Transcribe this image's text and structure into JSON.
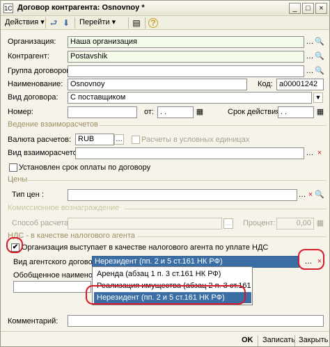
{
  "window": {
    "title": "Договор контрагента: Osnovnoy *",
    "icon_text": "1С"
  },
  "toolbar": {
    "actions": "Действия",
    "goto": "Перейти",
    "help": "?",
    "icons": [
      "write-back-icon",
      "down-arrow-icon",
      "table-icon"
    ]
  },
  "form": {
    "org_label": "Организация:",
    "org_value": "Наша организация",
    "contractor_label": "Контрагент:",
    "contractor_value": "Postavshik",
    "group_label": "Группа договоров:",
    "group_value": "",
    "name_label": "Наименование:",
    "name_value": "Osnovnoy",
    "code_label": "Код:",
    "code_value": "а00001242",
    "type_label": "Вид договора:",
    "type_value": "С поставщиком",
    "number_label": "Номер:",
    "number_value": "",
    "from_label": "от:",
    "from_value": " .  .",
    "term_label": "Срок действия:",
    "term_value": " .  .",
    "section_settlements": "Ведение взаиморасчетов",
    "currency_label": "Валюта расчетов:",
    "currency_value": "RUB",
    "conventional_label": "Расчеты в условных единицах",
    "settlement_type_label": "Вид взаиморасчетов:",
    "settlement_type_value": "",
    "payment_term_label": "Установлен срок оплаты по договору",
    "section_prices": "Цены",
    "price_type_label": "Тип цен :",
    "price_type_value": "",
    "section_commission": "Комиссионное вознаграждение",
    "calc_method_label": "Способ расчета:",
    "calc_method_value": "",
    "percent_label": "Процент:",
    "percent_value": "0,00",
    "section_vat": "НДС - в качестве налогового агента",
    "tax_agent_label": "Организация выступает в качестве налогового агента по уплате НДС",
    "agent_contract_label": "Вид агентского договора:",
    "agent_contract_value": "Нерезидент (пп. 2 и 5 ст.161 НК РФ)",
    "common_name_label": "Обобщенное наименование",
    "dropdown_options": [
      "Аренда (абзац 1 п. 3 ст.161 НК РФ)",
      "Реализация имущества (абзац 2 п. 3 ст.161 НК РФ)",
      "Нерезидент (пп. 2 и 5 ст.161 НК РФ)"
    ],
    "comment_label": "Комментарий:",
    "comment_value": ""
  },
  "footer": {
    "ok": "OK",
    "write": "Записать",
    "close": "Закрыть"
  },
  "colors": {
    "accent_red": "#d8192b",
    "selection_blue": "#3a6ea5",
    "section_label": "#9b8d60"
  }
}
